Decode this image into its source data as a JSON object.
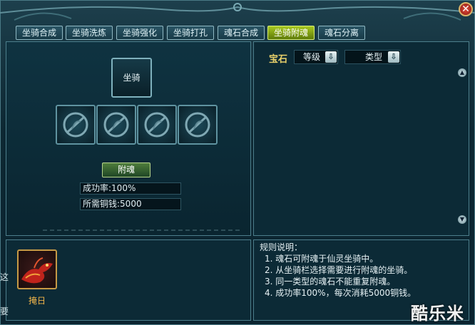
{
  "tabs": [
    {
      "label": "坐骑合成"
    },
    {
      "label": "坐骑洗炼"
    },
    {
      "label": "坐骑强化"
    },
    {
      "label": "坐骑打孔"
    },
    {
      "label": "魂石合成"
    },
    {
      "label": "坐骑附魂",
      "active": true
    },
    {
      "label": "魂石分离"
    }
  ],
  "close_label": "✕",
  "mount_slot_label": "坐骑",
  "attach_button": "附魂",
  "success_rate": "成功率:100%",
  "cost": "所需铜钱:5000",
  "gem_panel": {
    "title": "宝石",
    "grade_label": "等级",
    "type_label": "类型",
    "scroll_up": "▲",
    "scroll_down": "▼"
  },
  "rules": {
    "title": "规则说明：",
    "items": [
      "1. 魂石可附魂于仙灵坐骑中。",
      "2. 从坐骑栏选择需要进行附魂的坐骑。",
      "3. 同一类型的魂石不能重复附魂。",
      "4. 成功率100%，每次消耗5000铜钱。"
    ]
  },
  "mount_list": [
    {
      "name": "掩日",
      "icon": "red-dragon-mount-icon"
    }
  ],
  "side_text": [
    "这",
    "要"
  ],
  "watermark": "酷乐米",
  "colors": {
    "active_tab": "#8fb116",
    "gem_title": "#e8d06a",
    "mount_name": "#f2b64a"
  }
}
